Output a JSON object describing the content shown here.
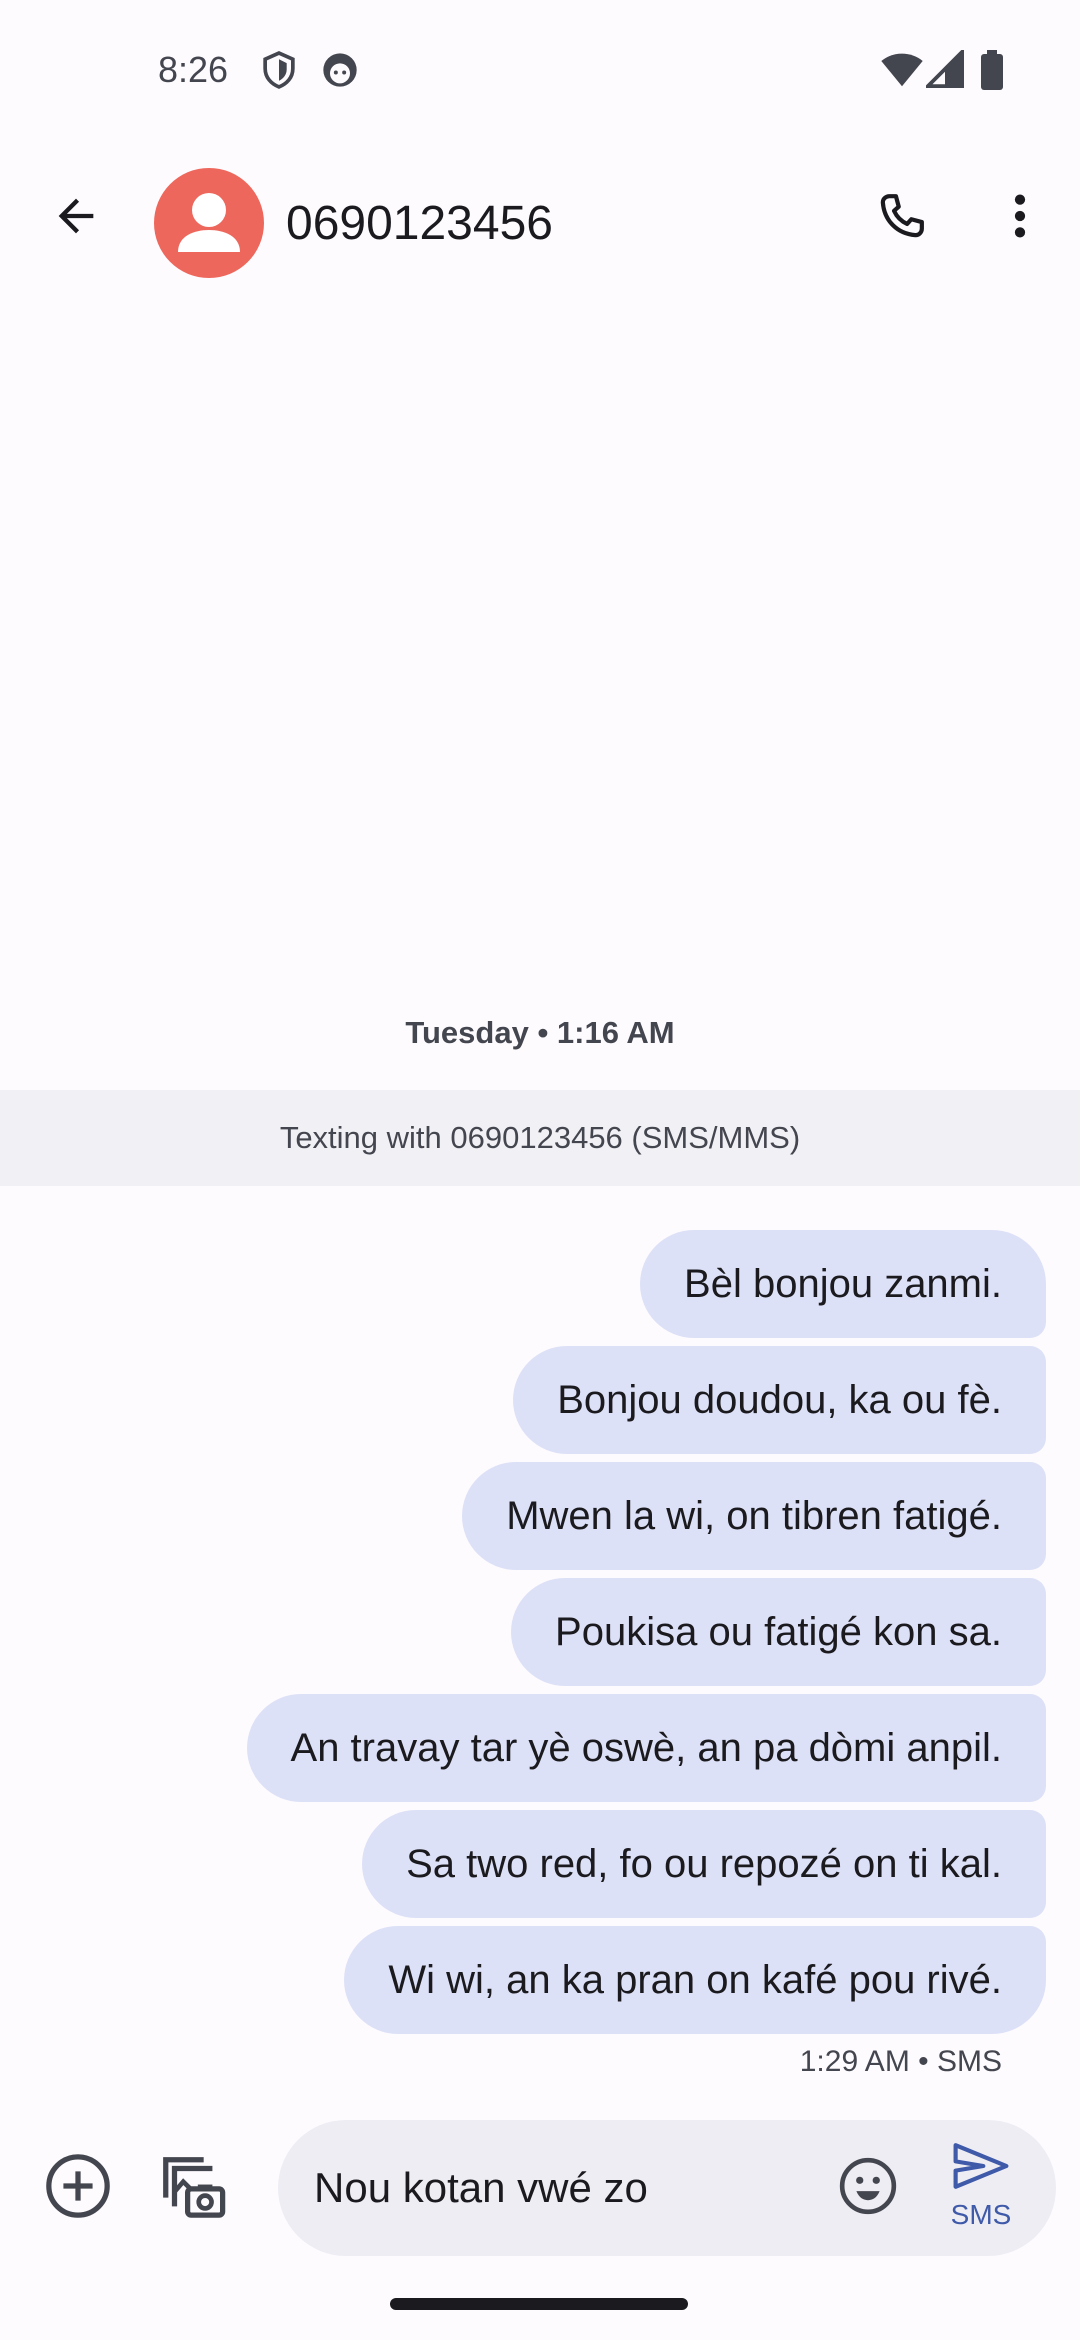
{
  "status_bar": {
    "time": "8:26",
    "icons": [
      "shield-icon",
      "face-icon",
      "wifi-icon",
      "cellular-icon",
      "battery-icon"
    ]
  },
  "app_bar": {
    "back_icon": "arrow-back-icon",
    "contact_name": "0690123456",
    "call_icon": "phone-icon",
    "more_icon": "more-vert-icon",
    "avatar_color": "#ee675c"
  },
  "conversation": {
    "date_label": "Tuesday • 1:16 AM",
    "texting_banner": "Texting with 0690123456 (SMS/MMS)",
    "messages": [
      "Bèl bonjou zanmi.",
      "Bonjou doudou, ka ou fè.",
      "Mwen la wi, on tibren fatigé.",
      "Poukisa ou fatigé kon sa.",
      "An travay tar yè oswè, an pa dòmi anpil.",
      "Sa two red, fo ou repozé on ti kal.",
      "Wi wi, an ka pran on kafé pou rivé."
    ],
    "last_message_meta": "1:29 AM • SMS",
    "bubble_color": "#dde1f7"
  },
  "compose": {
    "add_icon": "add-circle-icon",
    "gallery_icon": "gallery-camera-icon",
    "input_value": "Nou kotan vwé zo",
    "emoji_icon": "emoji-icon",
    "send_icon": "send-icon",
    "send_label": "SMS",
    "accent": "#3f5aa9"
  }
}
